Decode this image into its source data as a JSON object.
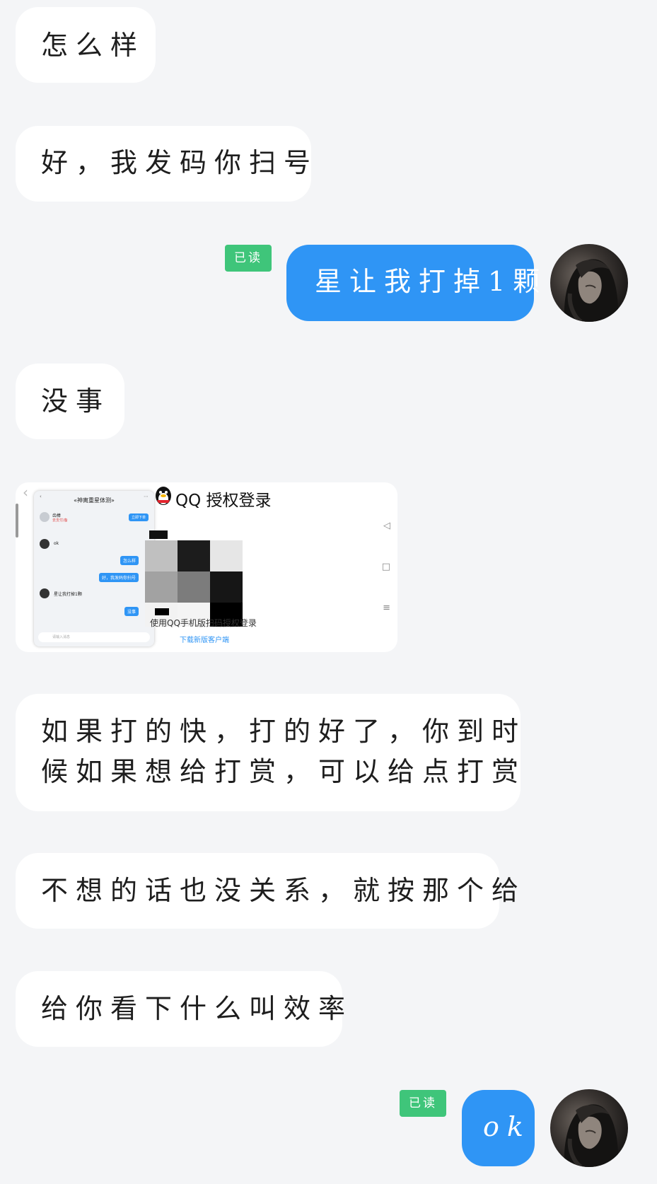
{
  "messages": {
    "m1": "怎么样",
    "m2": "好，我发码你扫号",
    "m3": "星让我打掉1颗",
    "m4": "没事",
    "m6_line1": "如果打的快，打的好了，你到时",
    "m6_line2": "候如果想给打赏，可以给点打赏",
    "m7": "不想的话也没关系，就按那个给",
    "m8": "给你看下什么叫效率",
    "m9": "ok"
  },
  "read_badge": "已读",
  "screenshot": {
    "qq_title": "QQ 授权登录",
    "caption": "使用QQ手机版扫码授权登录",
    "link": "下载新版客户端",
    "mini_chat": {
      "title": "«神离重星体测»",
      "pinned_name": "齿棒",
      "pinned_sub": "去支付/备",
      "pinned_button": "立即下单",
      "m1": "ok",
      "m2": "怎么样",
      "m3": "好，我发码你扫号",
      "m4": "星让我打掉1颗",
      "m5": "没事",
      "input_placeholder": "请输入消息"
    }
  },
  "colors": {
    "background": "#f4f5f7",
    "incoming_bubble": "#ffffff",
    "outgoing_bubble": "#2f95f5",
    "read_badge": "#3fc57a"
  }
}
